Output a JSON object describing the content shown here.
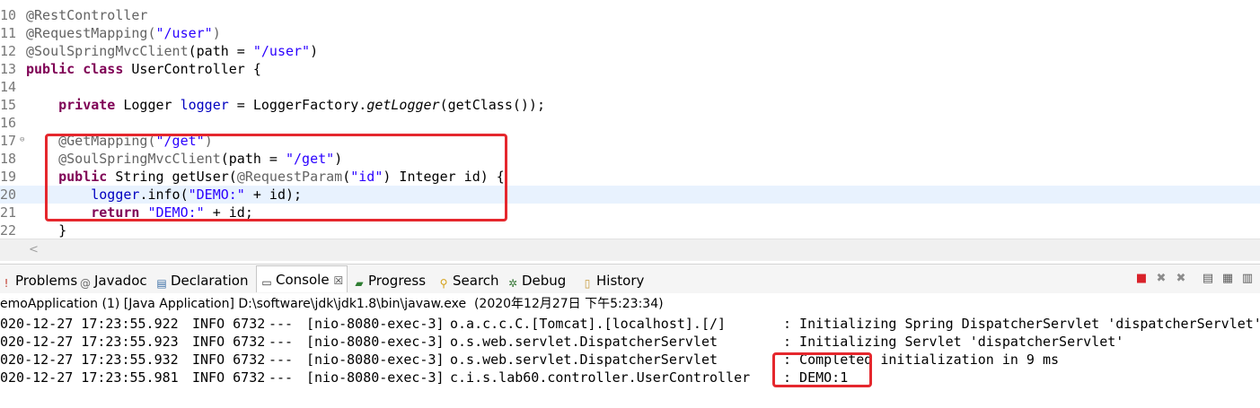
{
  "editor": {
    "lines": [
      {
        "num": "10",
        "segments": [
          {
            "cls": "ann",
            "text": "@RestController"
          }
        ]
      },
      {
        "num": "11",
        "segments": [
          {
            "cls": "ann",
            "text": "@RequestMapping("
          },
          {
            "cls": "str",
            "text": "\"/user\""
          },
          {
            "cls": "ann",
            "text": ")"
          }
        ]
      },
      {
        "num": "12",
        "segments": [
          {
            "cls": "ann",
            "text": "@SoulSpringMvcClient"
          },
          {
            "cls": "",
            "text": "(path = "
          },
          {
            "cls": "str",
            "text": "\"/user\""
          },
          {
            "cls": "",
            "text": ")"
          }
        ]
      },
      {
        "num": "13",
        "segments": [
          {
            "cls": "kw",
            "text": "public class"
          },
          {
            "cls": "",
            "text": " UserController {"
          }
        ]
      },
      {
        "num": "14",
        "segments": []
      },
      {
        "num": "15",
        "segments": [
          {
            "cls": "",
            "text": "    "
          },
          {
            "cls": "kw",
            "text": "private"
          },
          {
            "cls": "",
            "text": " Logger "
          },
          {
            "cls": "fld",
            "text": "logger"
          },
          {
            "cls": "",
            "text": " = LoggerFactory."
          },
          {
            "cls": "ital",
            "text": "getLogger"
          },
          {
            "cls": "",
            "text": "(getClass());"
          }
        ]
      },
      {
        "num": "16",
        "segments": []
      },
      {
        "num": "17",
        "segments": [
          {
            "cls": "",
            "text": "    "
          },
          {
            "cls": "ann",
            "text": "@GetMapping("
          },
          {
            "cls": "str",
            "text": "\"/get\""
          },
          {
            "cls": "ann",
            "text": ")"
          }
        ]
      },
      {
        "num": "18",
        "segments": [
          {
            "cls": "",
            "text": "    "
          },
          {
            "cls": "ann",
            "text": "@SoulSpringMvcClient"
          },
          {
            "cls": "",
            "text": "(path = "
          },
          {
            "cls": "str",
            "text": "\"/get\""
          },
          {
            "cls": "",
            "text": ")"
          }
        ]
      },
      {
        "num": "19",
        "segments": [
          {
            "cls": "",
            "text": "    "
          },
          {
            "cls": "kw",
            "text": "public"
          },
          {
            "cls": "",
            "text": " String getUser("
          },
          {
            "cls": "ann",
            "text": "@RequestParam"
          },
          {
            "cls": "",
            "text": "("
          },
          {
            "cls": "str",
            "text": "\"id\""
          },
          {
            "cls": "",
            "text": ") Integer id) {"
          }
        ]
      },
      {
        "num": "20",
        "segments": [
          {
            "cls": "",
            "text": "        "
          },
          {
            "cls": "fld",
            "text": "logger"
          },
          {
            "cls": "",
            "text": ".info("
          },
          {
            "cls": "str",
            "text": "\"DEMO:\""
          },
          {
            "cls": "",
            "text": " + id);"
          }
        ]
      },
      {
        "num": "21",
        "segments": [
          {
            "cls": "",
            "text": "        "
          },
          {
            "cls": "kw",
            "text": "return"
          },
          {
            "cls": "",
            "text": " "
          },
          {
            "cls": "str",
            "text": "\"DEMO:\""
          },
          {
            "cls": "",
            "text": " + id;"
          }
        ]
      },
      {
        "num": "22",
        "segments": [
          {
            "cls": "",
            "text": "    }"
          }
        ]
      }
    ],
    "current_line": "20",
    "hscroll_arrow": "<"
  },
  "tabs": [
    {
      "label": "Problems",
      "icon": "problems-icon",
      "glyph": "!",
      "active": false
    },
    {
      "label": "Javadoc",
      "icon": "javadoc-icon",
      "glyph": "@",
      "active": false
    },
    {
      "label": "Declaration",
      "icon": "declaration-icon",
      "glyph": "▤",
      "active": false
    },
    {
      "label": "Console",
      "icon": "console-icon",
      "glyph": "▭",
      "active": true,
      "close": "☒"
    },
    {
      "label": "Progress",
      "icon": "progress-icon",
      "glyph": "▰",
      "active": false
    },
    {
      "label": "Search",
      "icon": "search-icon",
      "glyph": "⚲",
      "active": false
    },
    {
      "label": "Debug",
      "icon": "debug-icon",
      "glyph": "✲",
      "active": false
    },
    {
      "label": "History",
      "icon": "history-icon",
      "glyph": "▯",
      "active": false
    }
  ],
  "console": {
    "title": "emoApplication (1) [Java Application] D:\\software\\jdk\\jdk1.8\\bin\\javaw.exe  (2020年12月27日 下午5:23:34)",
    "log_lines": [
      {
        "timestamp": "020-12-27 17:23:55.922",
        "level": "INFO 6732",
        "sep": "---",
        "thread": "[nio-8080-exec-3]",
        "logger": "o.a.c.c.C.[Tomcat].[localhost].[/]",
        "message": ": Initializing Spring DispatcherServlet 'dispatcherServlet'"
      },
      {
        "timestamp": "020-12-27 17:23:55.923",
        "level": "INFO 6732",
        "sep": "---",
        "thread": "[nio-8080-exec-3]",
        "logger": "o.s.web.servlet.DispatcherServlet",
        "message": ": Initializing Servlet 'dispatcherServlet'"
      },
      {
        "timestamp": "020-12-27 17:23:55.932",
        "level": "INFO 6732",
        "sep": "---",
        "thread": "[nio-8080-exec-3]",
        "logger": "o.s.web.servlet.DispatcherServlet",
        "message": ": Completed initialization in 9 ms"
      },
      {
        "timestamp": "020-12-27 17:23:55.981",
        "level": "INFO 6732",
        "sep": "---",
        "thread": "[nio-8080-exec-3]",
        "logger": "c.i.s.lab60.controller.UserController",
        "message": ": DEMO:1"
      }
    ]
  },
  "toolbar_icons": [
    "terminate-icon",
    "remove-launch-icon",
    "remove-all-icon",
    "scroll-lock-icon",
    "pin-console-icon",
    "open-console-icon"
  ],
  "colors": {
    "highlight": "#e5272d",
    "keyword": "#7f0055",
    "string": "#2a00ff",
    "annotation": "#646464",
    "field": "#0000c0"
  }
}
